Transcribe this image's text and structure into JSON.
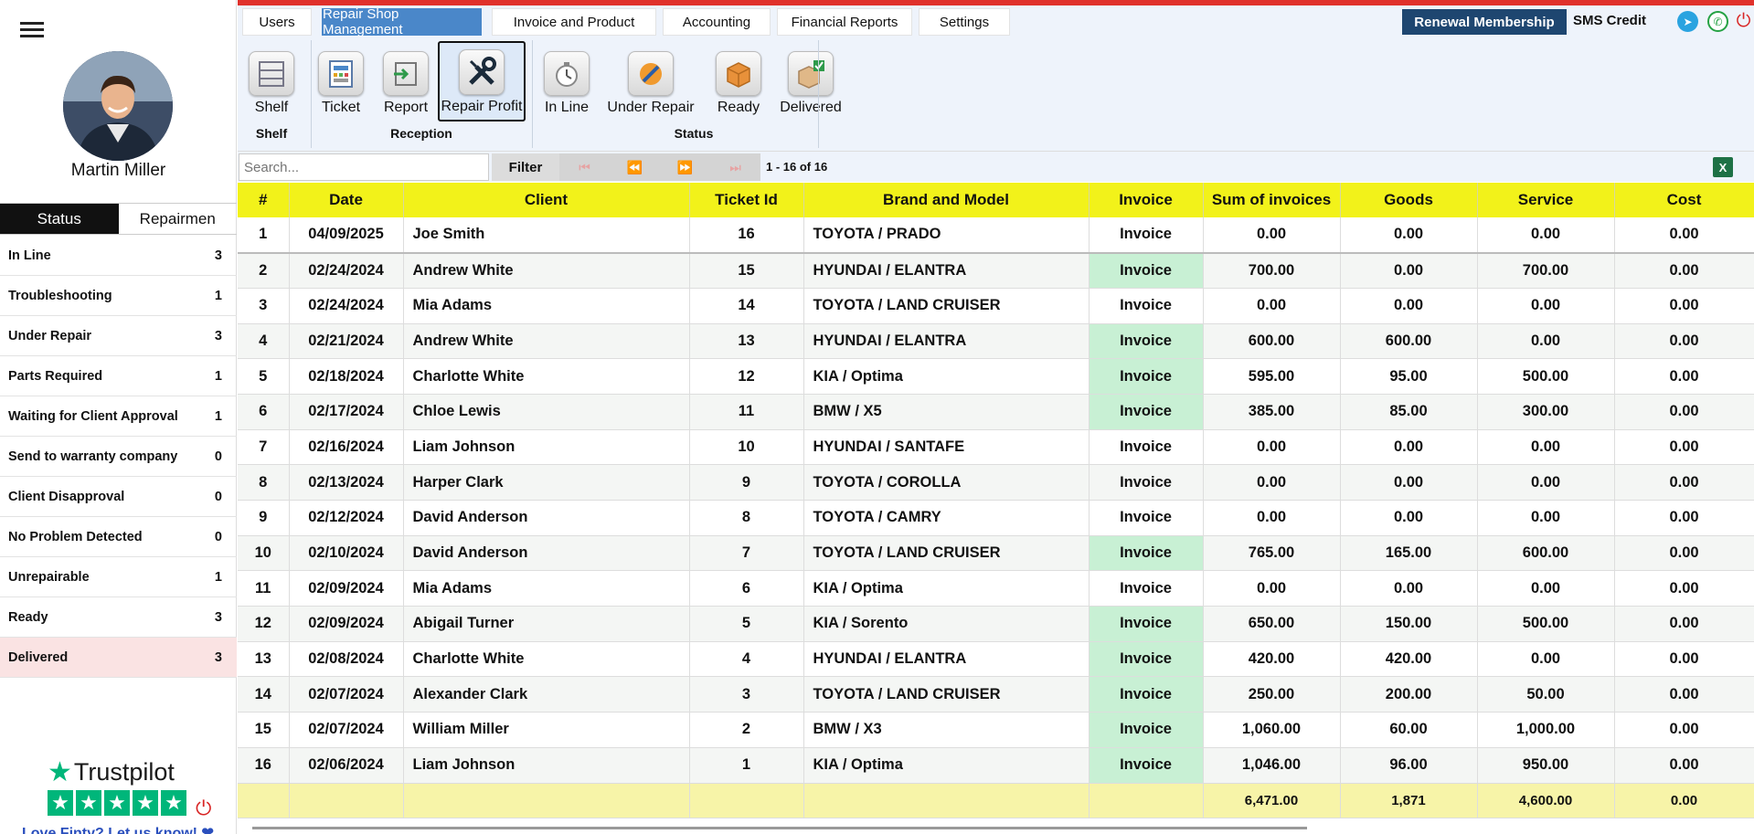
{
  "user": {
    "name": "Martin Miller"
  },
  "side_tabs": [
    {
      "label": "Status"
    },
    {
      "label": "Repairmen"
    }
  ],
  "status_list": [
    {
      "label": "In Line",
      "count": "3"
    },
    {
      "label": "Troubleshooting",
      "count": "1"
    },
    {
      "label": "Under Repair",
      "count": "3"
    },
    {
      "label": "Parts Required",
      "count": "1"
    },
    {
      "label": "Waiting for Client Approval",
      "count": "1"
    },
    {
      "label": "Send to warranty company",
      "count": "0"
    },
    {
      "label": "Client Disapproval",
      "count": "0"
    },
    {
      "label": "No Problem Detected",
      "count": "0"
    },
    {
      "label": "Unrepairable",
      "count": "1"
    },
    {
      "label": "Ready",
      "count": "3"
    },
    {
      "label": "Delivered",
      "count": "3"
    }
  ],
  "trustpilot": {
    "brand": "Trustpilot",
    "caption": "Love Finty? Let us know! ❤"
  },
  "menu": [
    {
      "label": "Users"
    },
    {
      "label": "Repair Shop Management"
    },
    {
      "label": "Invoice and Product"
    },
    {
      "label": "Accounting"
    },
    {
      "label": "Financial Reports"
    },
    {
      "label": "Settings"
    }
  ],
  "renewal_label": "Renewal Membership",
  "sms_credit_label": "SMS Credit",
  "toolbar": {
    "buttons": [
      {
        "label": "Shelf",
        "icon": "shelf-icon"
      },
      {
        "label": "Ticket",
        "icon": "ticket-icon"
      },
      {
        "label": "Report",
        "icon": "report-icon"
      },
      {
        "label": "Repair Profit",
        "icon": "tools-icon"
      },
      {
        "label": "In Line",
        "icon": "stopwatch-icon"
      },
      {
        "label": "Under Repair",
        "icon": "repair-icon"
      },
      {
        "label": "Ready",
        "icon": "box-icon"
      },
      {
        "label": "Delivered",
        "icon": "delivered-box-icon"
      }
    ],
    "groups": [
      {
        "label": "Shelf"
      },
      {
        "label": "Reception"
      },
      {
        "label": "Status"
      }
    ]
  },
  "search": {
    "placeholder": "Search..."
  },
  "filter_label": "Filter",
  "page_info": "1 - 16 of 16",
  "table": {
    "headers": [
      "#",
      "Date",
      "Client",
      "Ticket Id",
      "Brand and Model",
      "Invoice",
      "Sum of invoices",
      "Goods",
      "Service",
      "Cost"
    ],
    "rows": [
      [
        "1",
        "04/09/2025",
        "Joe Smith",
        "16",
        "TOYOTA / PRADO",
        "Invoice",
        "0.00",
        "0.00",
        "0.00",
        "0.00"
      ],
      [
        "2",
        "02/24/2024",
        "Andrew White",
        "15",
        "HYUNDAI / ELANTRA",
        "Invoice",
        "700.00",
        "0.00",
        "700.00",
        "0.00"
      ],
      [
        "3",
        "02/24/2024",
        "Mia Adams",
        "14",
        "TOYOTA / LAND CRUISER",
        "Invoice",
        "0.00",
        "0.00",
        "0.00",
        "0.00"
      ],
      [
        "4",
        "02/21/2024",
        "Andrew White",
        "13",
        "HYUNDAI / ELANTRA",
        "Invoice",
        "600.00",
        "600.00",
        "0.00",
        "0.00"
      ],
      [
        "5",
        "02/18/2024",
        "Charlotte White",
        "12",
        "KIA / Optima",
        "Invoice",
        "595.00",
        "95.00",
        "500.00",
        "0.00"
      ],
      [
        "6",
        "02/17/2024",
        "Chloe Lewis",
        "11",
        "BMW / X5",
        "Invoice",
        "385.00",
        "85.00",
        "300.00",
        "0.00"
      ],
      [
        "7",
        "02/16/2024",
        "Liam Johnson",
        "10",
        "HYUNDAI / SANTAFE",
        "Invoice",
        "0.00",
        "0.00",
        "0.00",
        "0.00"
      ],
      [
        "8",
        "02/13/2024",
        "Harper Clark",
        "9",
        "TOYOTA / COROLLA",
        "Invoice",
        "0.00",
        "0.00",
        "0.00",
        "0.00"
      ],
      [
        "9",
        "02/12/2024",
        "David Anderson",
        "8",
        "TOYOTA / CAMRY",
        "Invoice",
        "0.00",
        "0.00",
        "0.00",
        "0.00"
      ],
      [
        "10",
        "02/10/2024",
        "David Anderson",
        "7",
        "TOYOTA / LAND CRUISER",
        "Invoice",
        "765.00",
        "165.00",
        "600.00",
        "0.00"
      ],
      [
        "11",
        "02/09/2024",
        "Mia Adams",
        "6",
        "KIA / Optima",
        "Invoice",
        "0.00",
        "0.00",
        "0.00",
        "0.00"
      ],
      [
        "12",
        "02/09/2024",
        "Abigail Turner",
        "5",
        "KIA / Sorento",
        "Invoice",
        "650.00",
        "150.00",
        "500.00",
        "0.00"
      ],
      [
        "13",
        "02/08/2024",
        "Charlotte White",
        "4",
        "HYUNDAI / ELANTRA",
        "Invoice",
        "420.00",
        "420.00",
        "0.00",
        "0.00"
      ],
      [
        "14",
        "02/07/2024",
        "Alexander Clark",
        "3",
        "TOYOTA / LAND CRUISER",
        "Invoice",
        "250.00",
        "200.00",
        "50.00",
        "0.00"
      ],
      [
        "15",
        "02/07/2024",
        "William Miller",
        "2",
        "BMW / X3",
        "Invoice",
        "1,060.00",
        "60.00",
        "1,000.00",
        "0.00"
      ],
      [
        "16",
        "02/06/2024",
        "Liam Johnson",
        "1",
        "KIA / Optima",
        "Invoice",
        "1,046.00",
        "96.00",
        "950.00",
        "0.00"
      ]
    ],
    "invoiced_rows": [
      false,
      true,
      false,
      true,
      true,
      true,
      false,
      false,
      false,
      true,
      false,
      true,
      true,
      true,
      true,
      true
    ],
    "totals": [
      "",
      "",
      "",
      "",
      "",
      "",
      "6,471.00",
      "1,871",
      "4,600.00",
      "0.00"
    ]
  },
  "colors": {
    "accent": "#4a87c9",
    "header": "#f2f21a",
    "invoice_paid": "#c8f0d4",
    "totals": "#f7f4a8",
    "brand_red": "#e0312b"
  }
}
